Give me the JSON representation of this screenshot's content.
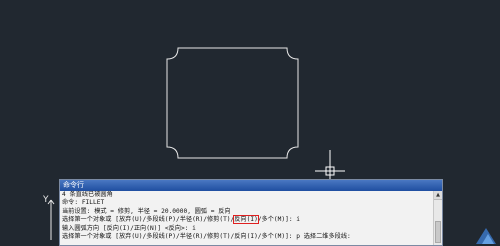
{
  "drawing": {
    "ucs_y_label": "Y",
    "colors": {
      "background": "#212830",
      "geometry": "#e9e9e9",
      "crosshair": "#ffffff",
      "highlight_box": "#e02020"
    }
  },
  "command_window": {
    "title": "命令行",
    "lines": [
      "4 条直线已被圆角",
      "命令: FILLET",
      "当前设置: 模式 = 修剪, 半径 = 20.0000, 圆弧 = 反向",
      "输入圆弧方向 [反向(I)/正向(N)] <反向>: i",
      "选择第一个对象或 [放弃(U)/多段线(P)/半径(R)/修剪(T)/反向(I)/多个(M)]: p 选择二维多段线:"
    ],
    "selection_line": {
      "prefix": "选择第一个对象或 [放弃(U)/多段线(P)/半径(R)/修剪(T)/",
      "highlighted": "反向(I)",
      "suffix": "/多个(M)]: i"
    }
  }
}
